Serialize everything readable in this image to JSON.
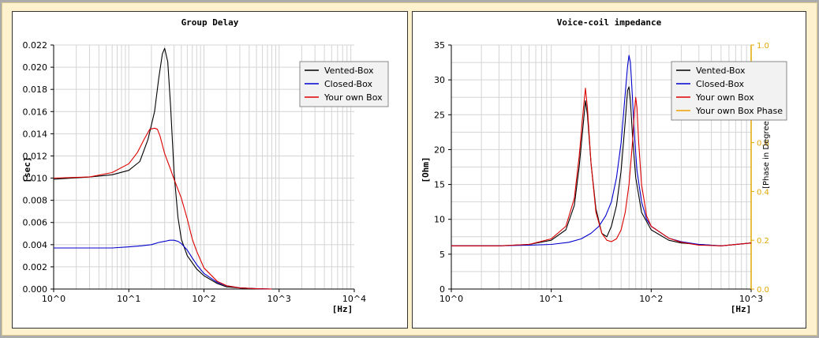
{
  "colors": {
    "vented": "#000000",
    "closed": "#0000cc",
    "own": "#dd0000",
    "phase": "#f0a000",
    "grid": "#d4d4d4",
    "phase_axis": "#e0a800"
  },
  "chart_data": [
    {
      "type": "line",
      "title": "Group Delay",
      "xlabel": "[Hz]",
      "ylabel": "[sec]",
      "xscale": "log",
      "xlim": [
        1,
        10000
      ],
      "ylim": [
        0,
        0.022
      ],
      "x_tick_labels": [
        "10^0",
        "10^1",
        "10^2",
        "10^3",
        "10^4"
      ],
      "y_tick_labels": [
        "0.000",
        "0.002",
        "0.004",
        "0.006",
        "0.008",
        "0.010",
        "0.012",
        "0.014",
        "0.016",
        "0.018",
        "0.020",
        "0.022"
      ],
      "grid": true,
      "legend_position": "top-right",
      "series": [
        {
          "name": "Vented-Box",
          "color_key": "vented",
          "x": [
            1,
            3,
            6,
            10,
            14,
            18,
            22,
            25,
            28,
            30,
            33,
            36,
            40,
            45,
            50,
            60,
            80,
            100,
            150,
            200,
            300,
            500,
            800
          ],
          "y": [
            0.0099,
            0.0101,
            0.0103,
            0.0107,
            0.0115,
            0.0135,
            0.016,
            0.019,
            0.0212,
            0.0217,
            0.0205,
            0.0165,
            0.0105,
            0.0065,
            0.0045,
            0.003,
            0.0018,
            0.0012,
            0.0005,
            0.0002,
            0.0001,
            3e-05,
            0.0
          ]
        },
        {
          "name": "Closed-Box",
          "color_key": "closed",
          "x": [
            1,
            3,
            6,
            10,
            15,
            20,
            25,
            30,
            35,
            40,
            45,
            50,
            60,
            70,
            80,
            100,
            150,
            200,
            300,
            500,
            800
          ],
          "y": [
            0.0037,
            0.0037,
            0.0037,
            0.0038,
            0.0039,
            0.004,
            0.0042,
            0.0043,
            0.0044,
            0.0044,
            0.0043,
            0.0041,
            0.0035,
            0.0028,
            0.0022,
            0.0014,
            0.0006,
            0.0003,
            0.0001,
            3e-05,
            0.0
          ]
        },
        {
          "name": "Your own Box",
          "color_key": "own",
          "x": [
            1,
            3,
            6,
            10,
            13,
            16,
            19,
            22,
            24,
            26,
            30,
            35,
            40,
            50,
            60,
            70,
            80,
            100,
            150,
            200,
            300,
            500,
            800
          ],
          "y": [
            0.01,
            0.0101,
            0.0105,
            0.0113,
            0.0123,
            0.0135,
            0.0144,
            0.0145,
            0.0144,
            0.0138,
            0.0122,
            0.011,
            0.0099,
            0.0082,
            0.0063,
            0.0045,
            0.0034,
            0.0019,
            0.0007,
            0.0003,
            0.0001,
            3e-05,
            0.0
          ]
        }
      ]
    },
    {
      "type": "line",
      "title": "Voice-coil impedance",
      "xlabel": "[Hz]",
      "ylabel": "[Ohm]",
      "ylabel_right": "[Phase in Degrees]",
      "xscale": "log",
      "xlim": [
        1,
        1000
      ],
      "ylim": [
        0,
        35
      ],
      "ylim_right": [
        0,
        1.0
      ],
      "x_tick_labels": [
        "10^0",
        "10^1",
        "10^2",
        "10^3"
      ],
      "y_tick_labels": [
        "0",
        "5",
        "10",
        "15",
        "20",
        "25",
        "30",
        "35"
      ],
      "y_tick_labels_right": [
        "0.0",
        "0.2",
        "0.4",
        "0.6",
        "0.8",
        "1.0"
      ],
      "grid": true,
      "legend_position": "top-right",
      "series": [
        {
          "name": "Vented-Box",
          "color_key": "vented",
          "x": [
            1,
            3,
            6,
            10,
            14,
            17,
            19,
            21,
            22,
            23,
            25,
            28,
            32,
            36,
            40,
            45,
            50,
            55,
            58,
            60,
            62,
            65,
            70,
            80,
            100,
            150,
            200,
            300,
            500,
            1000
          ],
          "y": [
            6.2,
            6.2,
            6.4,
            7.0,
            8.5,
            12.0,
            17.5,
            24.0,
            27.0,
            25.0,
            18.0,
            11.5,
            8.0,
            7.5,
            9.0,
            12.0,
            17.0,
            24.0,
            28.5,
            29.0,
            27.0,
            22.0,
            16.0,
            11.0,
            8.5,
            7.0,
            6.6,
            6.4,
            6.2,
            6.6
          ]
        },
        {
          "name": "Closed-Box",
          "color_key": "closed",
          "x": [
            1,
            3,
            6,
            10,
            15,
            20,
            25,
            30,
            35,
            40,
            45,
            50,
            55,
            58,
            60,
            62,
            64,
            68,
            72,
            80,
            90,
            100,
            150,
            200,
            300,
            500,
            1000
          ],
          "y": [
            6.2,
            6.2,
            6.3,
            6.4,
            6.7,
            7.2,
            8.0,
            9.0,
            10.5,
            12.5,
            16.0,
            21.0,
            28.0,
            32.0,
            33.5,
            32.5,
            29.0,
            22.0,
            17.0,
            12.5,
            10.0,
            9.0,
            7.3,
            6.8,
            6.4,
            6.2,
            6.6
          ]
        },
        {
          "name": "Your own Box",
          "color_key": "own",
          "x": [
            1,
            3,
            6,
            10,
            14,
            17,
            19,
            21,
            22,
            23,
            25,
            28,
            32,
            36,
            40,
            45,
            50,
            55,
            60,
            65,
            68,
            70,
            72,
            75,
            80,
            90,
            100,
            150,
            200,
            300,
            500,
            1000
          ],
          "y": [
            6.2,
            6.2,
            6.4,
            7.2,
            9.0,
            13.0,
            19.0,
            26.0,
            28.8,
            26.0,
            18.0,
            11.0,
            8.0,
            7.0,
            6.8,
            7.2,
            8.5,
            11.0,
            15.0,
            21.0,
            25.5,
            27.5,
            26.0,
            21.0,
            15.0,
            10.5,
            9.0,
            7.3,
            6.7,
            6.3,
            6.2,
            6.6
          ]
        },
        {
          "name": "Your own Box Phase",
          "color_key": "phase",
          "x": [],
          "y": []
        }
      ]
    }
  ]
}
